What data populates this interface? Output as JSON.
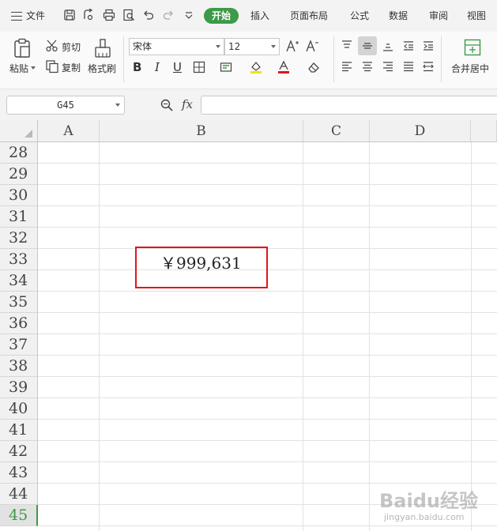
{
  "menu": {
    "file_label": "文件",
    "tabs": [
      {
        "label": "开始",
        "active": true
      },
      {
        "label": "插入"
      },
      {
        "label": "页面布局"
      },
      {
        "label": "公式"
      },
      {
        "label": "数据"
      },
      {
        "label": "审阅"
      },
      {
        "label": "视图"
      }
    ]
  },
  "toolbar": {
    "paste_label": "粘贴",
    "cut_label": "剪切",
    "copy_label": "复制",
    "format_painter_label": "格式刷",
    "font_name": "宋体",
    "font_size": "12",
    "bold": "B",
    "italic": "I",
    "underline": "U",
    "merge_center_label": "合并居中"
  },
  "formula_bar": {
    "name_box": "G45",
    "fx_label": "fx",
    "formula": ""
  },
  "grid": {
    "columns": [
      "A",
      "B",
      "C",
      "D"
    ],
    "rows": [
      "28",
      "29",
      "30",
      "31",
      "32",
      "33",
      "34",
      "35",
      "36",
      "37",
      "38",
      "39",
      "40",
      "41",
      "42",
      "43",
      "44",
      "45"
    ],
    "active_row": "45",
    "cell_value": "￥999,631"
  },
  "watermark": {
    "text": "Baidu经验",
    "sub": "jingyan.baidu.com"
  },
  "colors": {
    "accent": "#3c9a48",
    "highlight_border": "#e0161b"
  }
}
